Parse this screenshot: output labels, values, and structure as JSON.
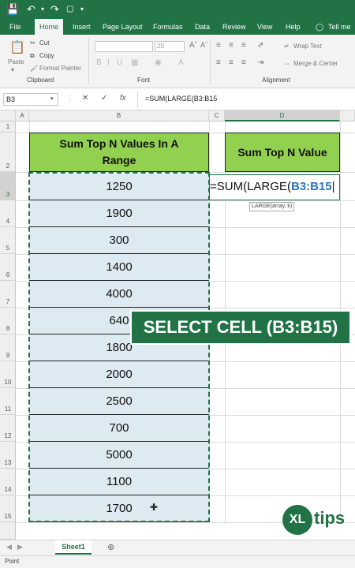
{
  "menu": {
    "tabs": [
      "File",
      "Home",
      "Insert",
      "Page Layout",
      "Formulas",
      "Data",
      "Review",
      "View",
      "Help"
    ],
    "tell_me": "Tell me"
  },
  "ribbon": {
    "cut": "Cut",
    "copy": "Copy",
    "paste": "Paste",
    "format_painter": "Format Painter",
    "font_size": "20",
    "wrap_text": "Wrap Text",
    "merge_center": "Merge & Center",
    "groups": {
      "clipboard": "Clipboard",
      "font": "Font",
      "alignment": "Alignment"
    }
  },
  "formula_bar": {
    "name_box": "B3",
    "fx": "fx",
    "formula": "=SUM(LARGE(B3:B15"
  },
  "columns": [
    "A",
    "B",
    "C",
    "D"
  ],
  "rows": [
    "1",
    "2",
    "3",
    "4",
    "5",
    "6",
    "7",
    "8",
    "9",
    "10",
    "11",
    "12",
    "13",
    "14",
    "15"
  ],
  "table": {
    "header": "Sum Top N Values In A Range",
    "values": [
      "1250",
      "1900",
      "300",
      "1400",
      "4000",
      "640",
      "1800",
      "2000",
      "2500",
      "700",
      "5000",
      "1100",
      "1700"
    ]
  },
  "result": {
    "header": "Sum Top N Value",
    "edit_prefix": "=SUM(LARGE(",
    "edit_paren": "(",
    "edit_ref": "B3:B15",
    "tooltip": "LARGE(array, k)"
  },
  "banner": "SELECT CELL (B3:B15)",
  "sheet": {
    "tab": "Sheet1",
    "status": "Point"
  },
  "logo": {
    "xl": "XL",
    "tips": "tips"
  },
  "colors": {
    "excel_green": "#217346",
    "header_green": "#92d050",
    "cell_blue": "#deeaf1"
  }
}
